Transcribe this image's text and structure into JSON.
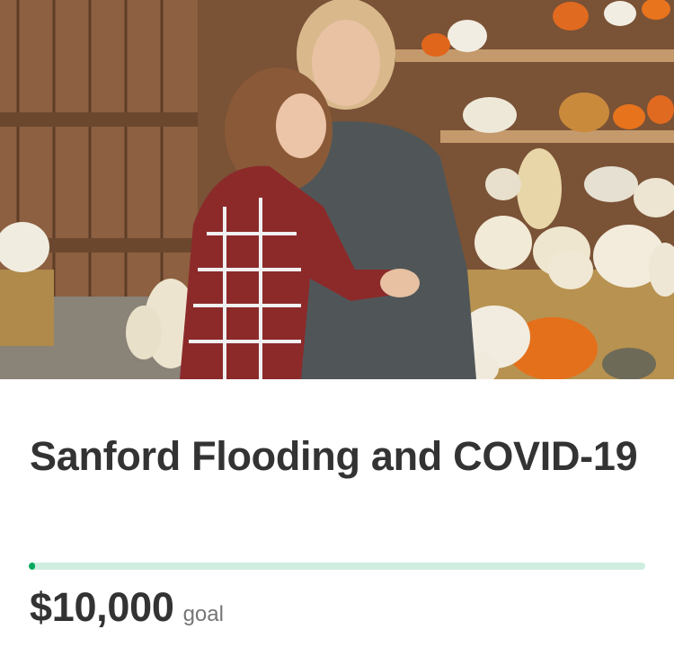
{
  "campaign": {
    "title": "Sanford Flooding and COVID-19",
    "goal_amount": "$10,000",
    "goal_label": "goal",
    "progress_fraction": 0.01
  },
  "hero": {
    "icon": "campaign-photo"
  },
  "colors": {
    "progress_fill": "#02a95c",
    "progress_track": "#cfeee0",
    "text": "#333333",
    "muted": "#767676"
  }
}
